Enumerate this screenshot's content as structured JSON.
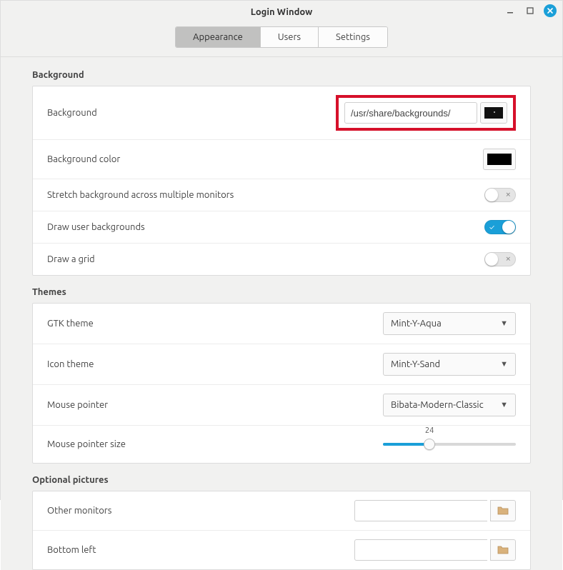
{
  "window": {
    "title": "Login Window"
  },
  "tabs": {
    "appearance": "Appearance",
    "users": "Users",
    "settings": "Settings",
    "active": "appearance"
  },
  "sections": {
    "background": {
      "title": "Background",
      "rows": {
        "bg_label": "Background",
        "bg_value": "/usr/share/backgrounds/",
        "bg_color_label": "Background color",
        "bg_color_value": "#000000",
        "stretch_label": "Stretch background across multiple monitors",
        "stretch_on": false,
        "draw_user_bg_label": "Draw user backgrounds",
        "draw_user_bg_on": true,
        "draw_grid_label": "Draw a grid",
        "draw_grid_on": false
      }
    },
    "themes": {
      "title": "Themes",
      "rows": {
        "gtk_label": "GTK theme",
        "gtk_value": "Mint-Y-Aqua",
        "icon_label": "Icon theme",
        "icon_value": "Mint-Y-Sand",
        "cursor_label": "Mouse pointer",
        "cursor_value": "Bibata-Modern-Classic",
        "cursor_size_label": "Mouse pointer size",
        "cursor_size_value": "24"
      }
    },
    "optional": {
      "title": "Optional pictures",
      "rows": {
        "other_label": "Other monitors",
        "other_value": "",
        "bottom_left_label": "Bottom left",
        "bottom_left_value": ""
      }
    }
  }
}
